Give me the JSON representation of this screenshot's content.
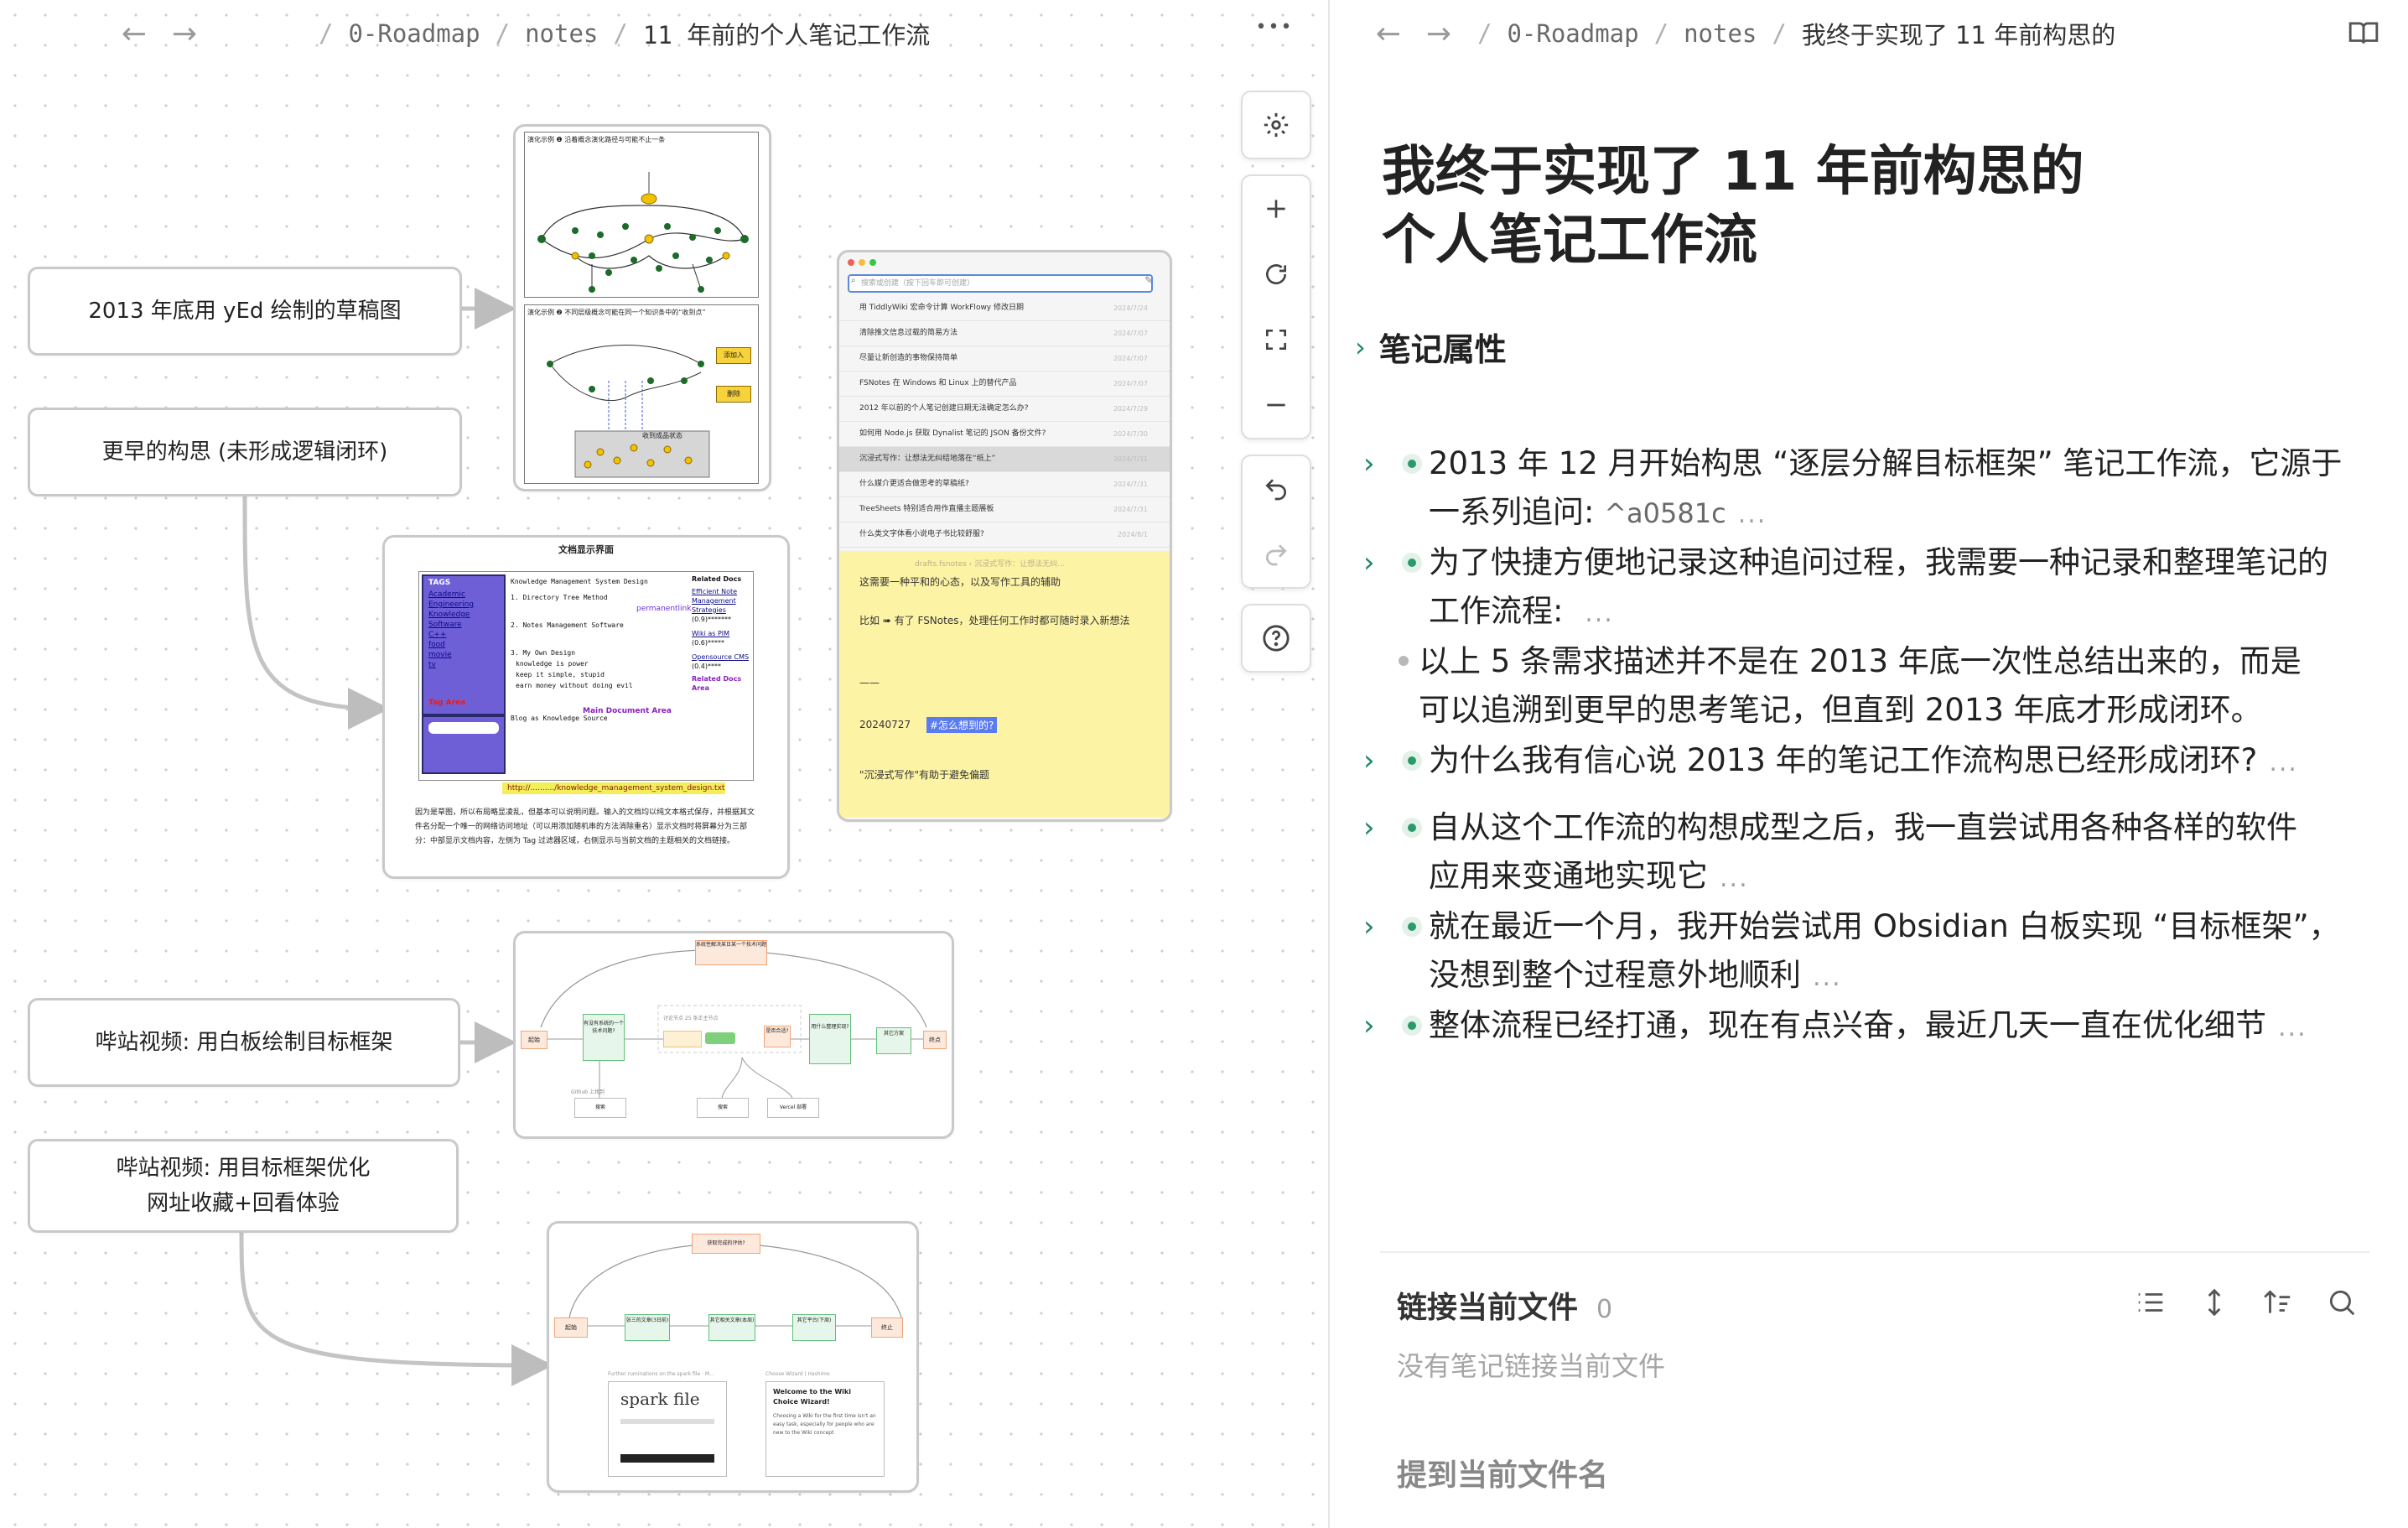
{
  "left": {
    "breadcrumb": [
      "0-Roadmap",
      "notes",
      "11 年前的个人笔记工作流"
    ],
    "sep": "/",
    "more_label": "•••",
    "nodes": {
      "n1": "2013 年底用 yEd 绘制的草稿图",
      "n2": "更早的构思 (未形成逻辑闭环)",
      "n3": "哔站视频: 用白板绘制目标框架",
      "n4a": "哔站视频: 用目标框架优化",
      "n4b": "网址收藏+回看体验"
    },
    "card_yed": {
      "top_header": "演化示例 ❶ 沿着概念演化路径与可能不止一条",
      "bottom_header": "演化示例 ❷ 不同层级概念可能在同一个知识条中的“收到点”",
      "tags": [
        "添加入",
        "删除"
      ],
      "footer_label": "收到成品状态"
    },
    "card_doc": {
      "title": "文档显示界面",
      "tags_title": "TAGS",
      "tags": [
        "Academic",
        "Engineering",
        "Knowledge",
        "Software",
        "C++",
        "food",
        "movie",
        "tv"
      ],
      "tag_area": "Tag Area",
      "tree": [
        "Knowledge Management System Design",
        "1. Directory Tree Method",
        "2. Notes Management Software",
        "3. My Own Design",
        "knowledge is power",
        "keep it simple, stupid",
        "earn money without doing evil",
        "Blog as Knowledge Source"
      ],
      "permanent": "permanentlink",
      "main_area": "Main Document Area",
      "related_title": "Related Docs",
      "related": [
        "Efficient Note Management Strategies",
        "(0.9)*******",
        "Wiki as PIM",
        "(0.6)*****",
        "Opensource CMS",
        "(0.4)****"
      ],
      "related_area": "Related Docs Area",
      "url": "http://........../knowledge_management_system_design.txt",
      "caption": "因为是草图，所以布局略显凌乱，但基本可以说明问题。输入的文档均以纯文本格式保存，并根据其文件名分配一个唯一的网络访问地址（可以用添加随机串的方法消除重名）显示文档时将屏幕分为三部分：中部显示文档内容，左侧为 Tag 过滤器区域，右侧显示与当前文档的主题相关的文档链接。"
    },
    "card_list": {
      "search_placeholder": "搜索或创建（按下回车即可创建）",
      "rows": [
        {
          "t": "用 TiddlyWiki 宏命令计算 WorkFlowy 修改日期",
          "d": "2024/7/24"
        },
        {
          "t": "清除推文信息过载的简易方法",
          "d": "2024/7/07"
        },
        {
          "t": "尽量让新创造的事物保持简单",
          "d": "2024/7/07"
        },
        {
          "t": "FSNotes 在 Windows 和 Linux 上的替代产品",
          "d": "2024/7/07"
        },
        {
          "t": "2012 年以前的个人笔记创建日期无法确定怎么办?",
          "d": "2024/7/29"
        },
        {
          "t": "如何用 Node.js 获取 Dynalist 笔记的 JSON 备份文件?",
          "d": "2024/7/30"
        },
        {
          "t": "沉浸式写作：让想法无纠结地落在“纸上”",
          "d": "2024/7/31"
        },
        {
          "t": "什么媒介更适合做思考的草稿纸?",
          "d": "2024/7/31"
        },
        {
          "t": "TreeSheets 特别适合用作直播主题展板",
          "d": "2024/7/31"
        },
        {
          "t": "什么类文字体看小说电子书比较舒服?",
          "d": "2024/8/1"
        }
      ],
      "path": "drafts.fsnotes › 沉浸式写作：让想法无纠...",
      "body1": "这需要一种平和的心态，以及写作工具的辅助",
      "body2": "比如 ➠ 有了 FSNotes，处理任何工作时都可随时录入新想法",
      "dash": "——",
      "date": "20240727",
      "tag": "#怎么想到的?",
      "body3": "\"沉浸式写作\"有助于避免偏题"
    },
    "card_flow1": {
      "top": "系统性解决某日某一个技术问题",
      "start": "起始",
      "end": "终点",
      "mid_label": "讨论节点 25 条正主节点",
      "b1": "有没有系统的一个技术问题?",
      "b2": "用什么整理实现?",
      "b3": "其它方案",
      "g1": "是否合适?",
      "sub1": "Github 上找到",
      "sub2": "搜索",
      "sub3": "Vercel 部署"
    },
    "card_flow2": {
      "top": "获取完成的评估?",
      "start": "起始",
      "end": "终止",
      "b1": "张三的文章(3日前)",
      "b2": "其它相关文章(本周)",
      "b3": "其它平台(下周)",
      "left_caption": "Further ruminations on the spark file · M...",
      "right_caption": "Choose Wizard | Hashimo",
      "spark": "spark file",
      "welcome": "Welcome to the Wiki Choice Wizard!",
      "welcome_body": "Choosing a Wiki for the first time isn't an easy task, especially for people who are new to the Wiki concept"
    },
    "tools": [
      "gear-icon",
      "plus-icon",
      "reset-icon",
      "fit-icon",
      "minus-icon",
      "undo-icon",
      "redo-icon",
      "help-icon"
    ]
  },
  "right": {
    "breadcrumb": [
      "0-Roadmap",
      "notes",
      "我终于实现了 11 年前构思的"
    ],
    "title_line1": "我终于实现了 11 年前构思的",
    "title_line2": "个人笔记工作流",
    "properties": "笔记属性",
    "bullets": [
      {
        "l1": "2013 年 12 月开始构思 “逐层分解目标框架” 笔记工作流，它源于",
        "l2": "一系列追问: ",
        "ref": "^a0581c",
        "ell": "...",
        "type": "parent"
      },
      {
        "l1": "为了快捷方便地记录这种追问过程，我需要一种记录和整理笔记的",
        "l2": "工作流程: ",
        "ref": "",
        "ell": "...",
        "type": "parent"
      },
      {
        "l1": "以上 5 条需求描述并不是在 2013 年底一次性总结出来的，而是",
        "l2": "可以追溯到更早的思考笔记，但直到 2013 年底才形成闭环。",
        "ref": "",
        "ell": "",
        "type": "child"
      },
      {
        "l1": "为什么我有信心说 2013 年的笔记工作流构思已经形成闭环?",
        "l2": "",
        "ref": "",
        "ell": "...",
        "type": "parent"
      },
      {
        "l1": "自从这个工作流的构想成型之后，我一直尝试用各种各样的软件",
        "l2": "应用来变通地实现它",
        "ref": "",
        "ell": "...",
        "type": "parent"
      },
      {
        "l1": "就在最近一个月，我开始尝试用 Obsidian 白板实现 “目标框架”，",
        "l2": "没想到整个过程意外地顺利",
        "ref": "",
        "ell": "...",
        "type": "parent"
      },
      {
        "l1": "整体流程已经打通，现在有点兴奋，最近几天一直在优化细节",
        "l2": "",
        "ref": "",
        "ell": "...",
        "type": "parent"
      }
    ],
    "backlinks_title": "链接当前文件",
    "backlinks_count": "0",
    "backlinks_empty": "没有笔记链接当前文件",
    "mentions_title": "提到当前文件名"
  }
}
